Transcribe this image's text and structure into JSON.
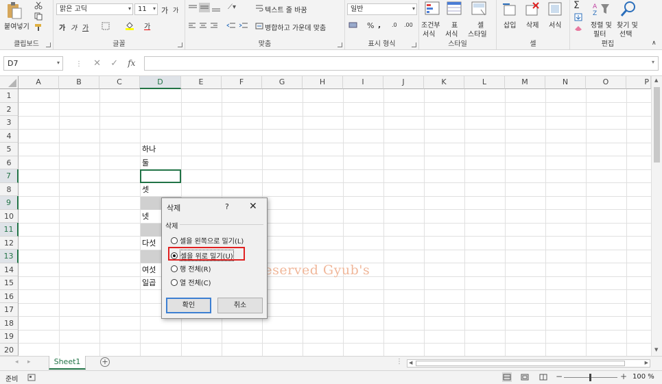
{
  "ribbon": {
    "clipboard": {
      "paste_label": "붙여넣기",
      "group_label": "클립보드"
    },
    "font": {
      "font_name": "맑은 고딕",
      "font_size": "11",
      "bold": "가",
      "italic": "가",
      "underline": "가",
      "grow": "가",
      "shrink": "가",
      "font_color_label": "가",
      "group_label": "글꼴"
    },
    "alignment": {
      "wrap_text": "텍스트 줄 바꿈",
      "merge_center": "병합하고 가운데 맞춤",
      "group_label": "맞춤"
    },
    "number": {
      "format": "일반",
      "percent": "%",
      "comma": ",",
      "group_label": "표시 형식"
    },
    "styles": {
      "conditional_1": "조건부",
      "conditional_2": "서식",
      "table_1": "표",
      "table_2": "서식",
      "cell_1": "셀",
      "cell_2": "스타일",
      "group_label": "스타일"
    },
    "cells": {
      "insert": "삽입",
      "delete": "삭제",
      "format": "서식",
      "group_label": "셀"
    },
    "editing": {
      "sort_1": "정렬 및",
      "sort_2": "필터",
      "find_1": "찾기 및",
      "find_2": "선택",
      "group_label": "편집"
    }
  },
  "formula_bar": {
    "name_box": "D7",
    "fx": "fx",
    "formula": ""
  },
  "columns": [
    "A",
    "B",
    "C",
    "D",
    "E",
    "F",
    "G",
    "H",
    "I",
    "J",
    "K",
    "L",
    "M",
    "N",
    "O",
    "P"
  ],
  "rows": [
    "1",
    "2",
    "3",
    "4",
    "5",
    "6",
    "7",
    "8",
    "9",
    "10",
    "11",
    "12",
    "13",
    "14",
    "15",
    "16",
    "17",
    "18",
    "19",
    "20"
  ],
  "cells": {
    "d5": "하나",
    "d6": "둘",
    "d8": "셋",
    "d10": "넷",
    "d12": "다섯",
    "d14": "여섯",
    "d15": "일곱"
  },
  "dialog": {
    "title": "삭제",
    "help": "?",
    "close": "✕",
    "group_label": "삭제",
    "options": [
      {
        "label": "셀을 왼쪽으로 밀기(L)",
        "selected": false
      },
      {
        "label": "셀을 위로 밀기(U)",
        "selected": true
      },
      {
        "label": "행 전체(R)",
        "selected": false
      },
      {
        "label": "열 전체(C)",
        "selected": false
      }
    ],
    "ok": "확인",
    "cancel": "취소"
  },
  "watermark": "All Rights Reserved Gyub's",
  "sheet_tab": "Sheet1",
  "status": {
    "mode": "준비",
    "zoom": "100 %"
  },
  "colors": {
    "excel_green": "#217346",
    "highlight_red": "#e02020",
    "gray_cell": "#d0d0d0"
  }
}
